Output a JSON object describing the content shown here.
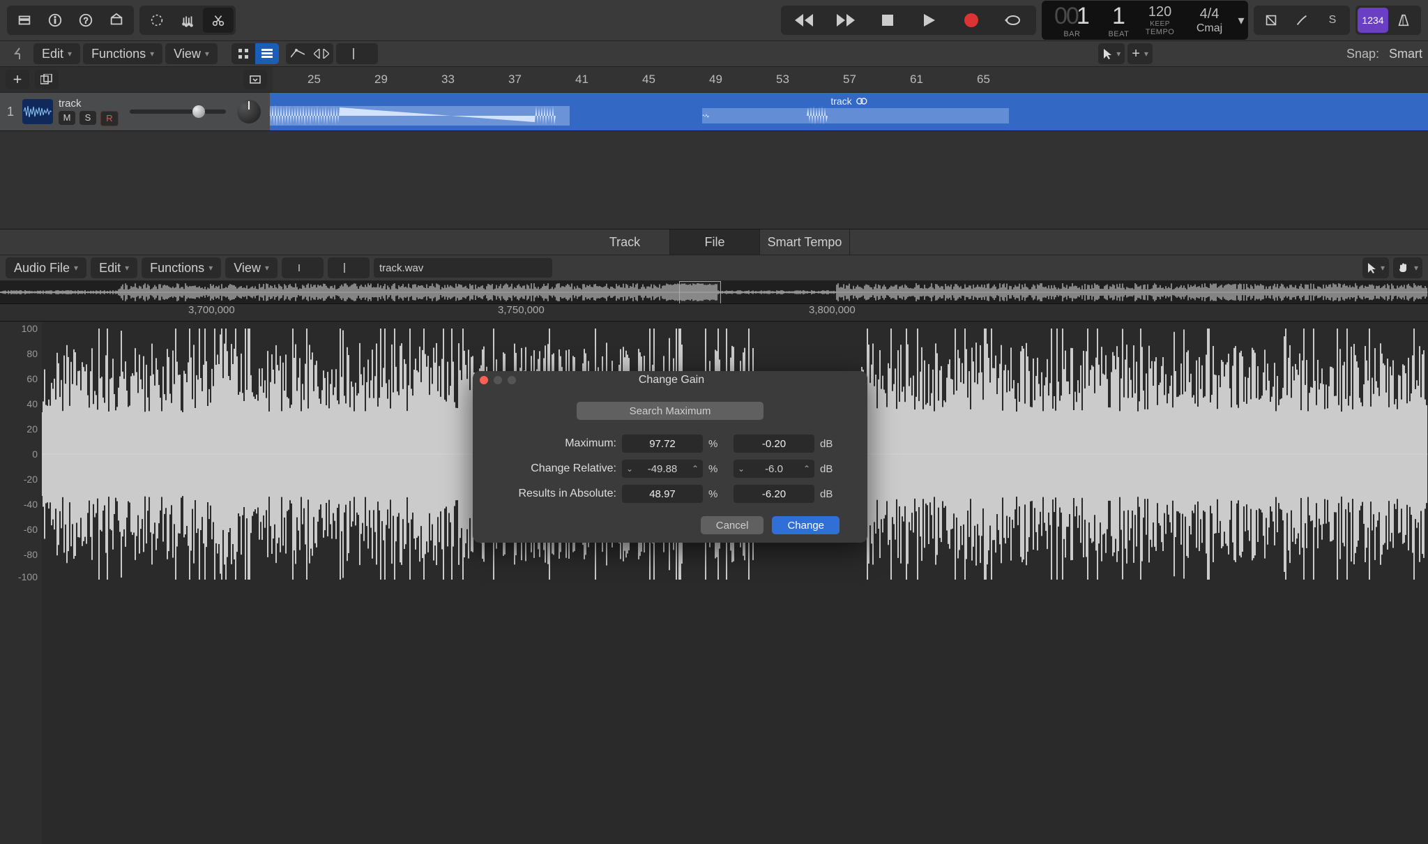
{
  "toolbar": {},
  "lcd": {
    "bar_pad": "00",
    "bar": "1",
    "bar_sub": "BAR",
    "beat": "1",
    "beat_sub": "BEAT",
    "tempo": "120",
    "tempo_mode": "KEEP",
    "tempo_sub": "TEMPO",
    "sig": "4/4",
    "key": "Cmaj"
  },
  "master_label": "1234",
  "trackbar": {
    "edit": "Edit",
    "functions": "Functions",
    "view": "View",
    "snap_label": "Snap:",
    "snap_value": "Smart"
  },
  "ruler_marks": [
    "25",
    "29",
    "33",
    "37",
    "41",
    "45",
    "49",
    "53",
    "57",
    "61",
    "65"
  ],
  "track": {
    "number": "1",
    "name": "track",
    "m": "M",
    "s": "S",
    "r": "R",
    "region_label": "track"
  },
  "editor": {
    "tabs": {
      "track": "Track",
      "file": "File",
      "smart": "Smart Tempo"
    },
    "audio_file": "Audio File",
    "edit": "Edit",
    "functions": "Functions",
    "view": "View",
    "filename": "track.wav"
  },
  "sample_ruler": [
    "3,700,000",
    "3,750,000",
    "3,800,000"
  ],
  "amp_ticks": [
    "100",
    "80",
    "60",
    "40",
    "20",
    "0",
    "-20",
    "-40",
    "-60",
    "-80",
    "-100"
  ],
  "dialog": {
    "title": "Change Gain",
    "search_btn": "Search Maximum",
    "labels": {
      "max": "Maximum:",
      "rel": "Change Relative:",
      "abs": "Results in Absolute:"
    },
    "max_pct": "97.72",
    "max_db": "-0.20",
    "rel_pct": "-49.88",
    "rel_db": "-6.0",
    "abs_pct": "48.97",
    "abs_db": "-6.20",
    "pct": "%",
    "db": "dB",
    "cancel": "Cancel",
    "change": "Change"
  }
}
